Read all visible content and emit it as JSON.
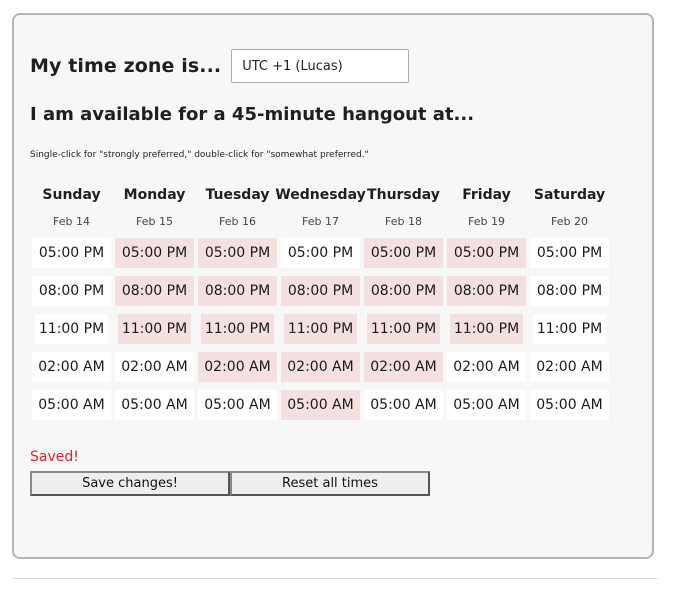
{
  "timezone": {
    "label": "My time zone is...",
    "value": "UTC +1 (Lucas)"
  },
  "headline": "I am available for a 45-minute hangout at...",
  "hint": "Single-click for \"strongly preferred,\" double-click for \"somewhat preferred.\"",
  "colors": {
    "preferred": "#f4e0e1",
    "unselected": "#ffffff",
    "saved_text": "#e0212b"
  },
  "days": [
    {
      "name": "Sunday",
      "date": "Feb 14",
      "slots": [
        {
          "time": "05:00 PM",
          "selected": false
        },
        {
          "time": "08:00 PM",
          "selected": false
        },
        {
          "time": "11:00 PM",
          "selected": false
        },
        {
          "time": "02:00 AM",
          "selected": false
        },
        {
          "time": "05:00 AM",
          "selected": false
        }
      ]
    },
    {
      "name": "Monday",
      "date": "Feb 15",
      "slots": [
        {
          "time": "05:00 PM",
          "selected": true
        },
        {
          "time": "08:00 PM",
          "selected": true
        },
        {
          "time": "11:00 PM",
          "selected": true
        },
        {
          "time": "02:00 AM",
          "selected": false
        },
        {
          "time": "05:00 AM",
          "selected": false
        }
      ]
    },
    {
      "name": "Tuesday",
      "date": "Feb 16",
      "slots": [
        {
          "time": "05:00 PM",
          "selected": true
        },
        {
          "time": "08:00 PM",
          "selected": true
        },
        {
          "time": "11:00 PM",
          "selected": true
        },
        {
          "time": "02:00 AM",
          "selected": true
        },
        {
          "time": "05:00 AM",
          "selected": false
        }
      ]
    },
    {
      "name": "Wednesday",
      "date": "Feb 17",
      "slots": [
        {
          "time": "05:00 PM",
          "selected": false
        },
        {
          "time": "08:00 PM",
          "selected": true
        },
        {
          "time": "11:00 PM",
          "selected": true
        },
        {
          "time": "02:00 AM",
          "selected": true
        },
        {
          "time": "05:00 AM",
          "selected": true
        }
      ]
    },
    {
      "name": "Thursday",
      "date": "Feb 18",
      "slots": [
        {
          "time": "05:00 PM",
          "selected": true
        },
        {
          "time": "08:00 PM",
          "selected": true
        },
        {
          "time": "11:00 PM",
          "selected": true
        },
        {
          "time": "02:00 AM",
          "selected": true
        },
        {
          "time": "05:00 AM",
          "selected": false
        }
      ]
    },
    {
      "name": "Friday",
      "date": "Feb 19",
      "slots": [
        {
          "time": "05:00 PM",
          "selected": true
        },
        {
          "time": "08:00 PM",
          "selected": true
        },
        {
          "time": "11:00 PM",
          "selected": true
        },
        {
          "time": "02:00 AM",
          "selected": false
        },
        {
          "time": "05:00 AM",
          "selected": false
        }
      ]
    },
    {
      "name": "Saturday",
      "date": "Feb 20",
      "slots": [
        {
          "time": "05:00 PM",
          "selected": false
        },
        {
          "time": "08:00 PM",
          "selected": false
        },
        {
          "time": "11:00 PM",
          "selected": false
        },
        {
          "time": "02:00 AM",
          "selected": false
        },
        {
          "time": "05:00 AM",
          "selected": false
        }
      ]
    }
  ],
  "status": "Saved!",
  "buttons": {
    "save": "Save changes!",
    "reset": "Reset all times"
  }
}
